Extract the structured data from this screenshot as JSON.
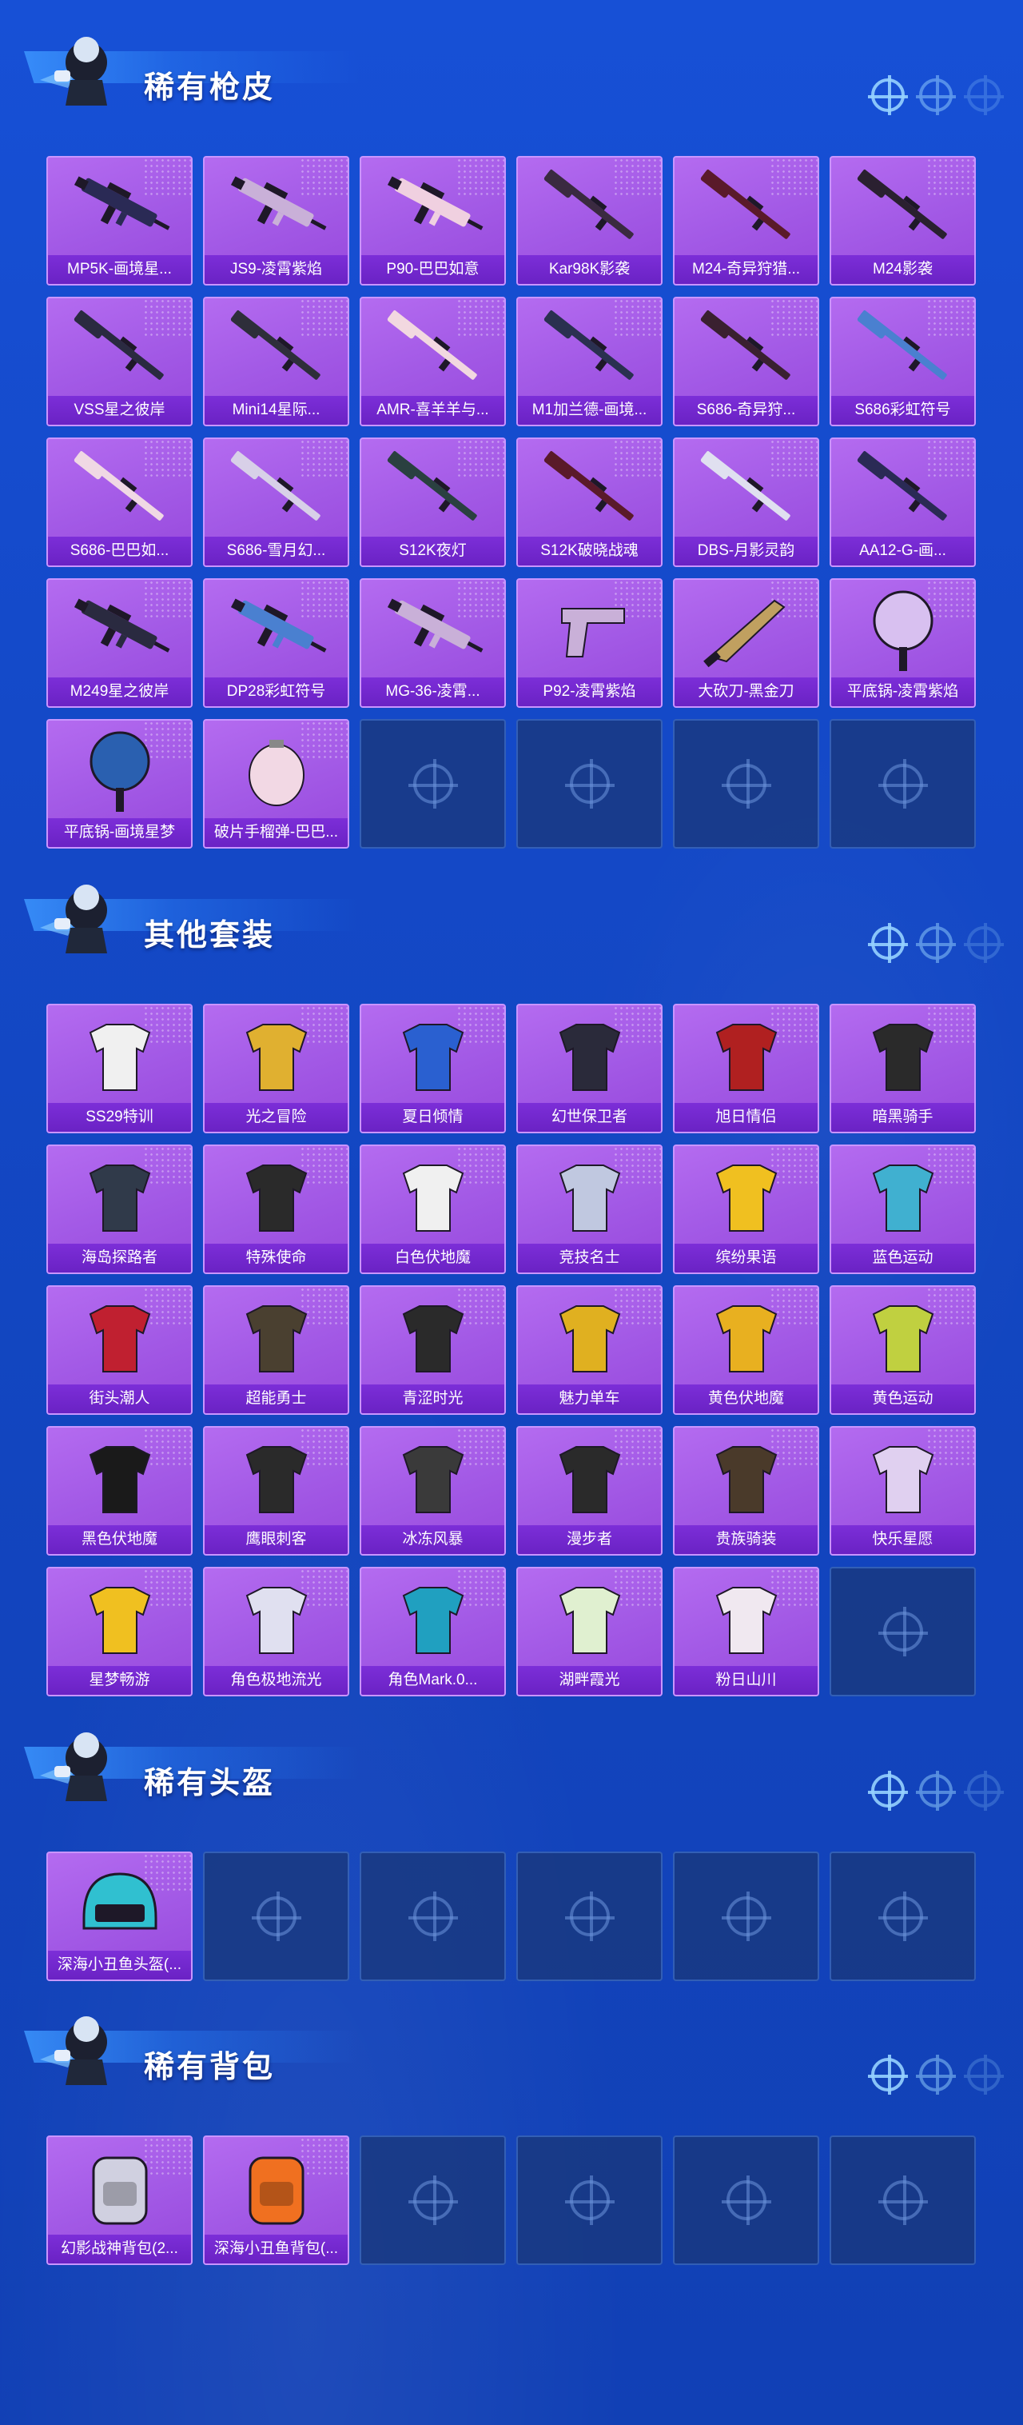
{
  "sections": [
    {
      "title": "稀有枪皮",
      "rows": 5,
      "items": [
        {
          "label": "MP5K-画境星...",
          "icon": "smg-icon",
          "color": "#2a2a55"
        },
        {
          "label": "JS9-凌霄紫焰",
          "icon": "smg-icon",
          "color": "#c9b0d8"
        },
        {
          "label": "P90-巴巴如意",
          "icon": "smg-icon",
          "color": "#f0d0e0"
        },
        {
          "label": "Kar98K影袭",
          "icon": "rifle-icon",
          "color": "#3a2a40"
        },
        {
          "label": "M24-奇异狩猎...",
          "icon": "rifle-icon",
          "color": "#5a1a2a"
        },
        {
          "label": "M24影袭",
          "icon": "rifle-icon",
          "color": "#2a2030"
        },
        {
          "label": "VSS星之彼岸",
          "icon": "rifle-icon",
          "color": "#2a2a40"
        },
        {
          "label": "Mini14星际...",
          "icon": "rifle-icon",
          "color": "#2e2e3a"
        },
        {
          "label": "AMR-喜羊羊与...",
          "icon": "rifle-icon",
          "color": "#f2d8e0"
        },
        {
          "label": "M1加兰德-画境...",
          "icon": "rifle-icon",
          "color": "#2a3050"
        },
        {
          "label": "S686-奇异狩...",
          "icon": "shotgun-icon",
          "color": "#3a2030"
        },
        {
          "label": "S686彩虹符号",
          "icon": "shotgun-icon",
          "color": "#4a80d0"
        },
        {
          "label": "S686-巴巴如...",
          "icon": "shotgun-icon",
          "color": "#f0d8e4"
        },
        {
          "label": "S686-雪月幻...",
          "icon": "shotgun-icon",
          "color": "#d8d0e8"
        },
        {
          "label": "S12K夜灯",
          "icon": "shotgun-icon",
          "color": "#2a4040"
        },
        {
          "label": "S12K破晓战魂",
          "icon": "shotgun-icon",
          "color": "#5a1a2a"
        },
        {
          "label": "DBS-月影灵韵",
          "icon": "shotgun-icon",
          "color": "#e0e0f0"
        },
        {
          "label": "AA12-G-画...",
          "icon": "shotgun-icon",
          "color": "#2a2a55"
        },
        {
          "label": "M249星之彼岸",
          "icon": "lmg-icon",
          "color": "#2a2a40"
        },
        {
          "label": "DP28彩虹符号",
          "icon": "lmg-icon",
          "color": "#4a80d0"
        },
        {
          "label": "MG-36-凌霄...",
          "icon": "lmg-icon",
          "color": "#c9b0d8"
        },
        {
          "label": "P92-凌霄紫焰",
          "icon": "pistol-icon",
          "color": "#c9b0d8"
        },
        {
          "label": "大砍刀-黑金刀",
          "icon": "machete-icon",
          "color": "#2a2a2a"
        },
        {
          "label": "平底锅-凌霄紫焰",
          "icon": "pan-icon",
          "color": "#d8c0f0"
        },
        {
          "label": "平底锅-画境星梦",
          "icon": "pan-icon",
          "color": "#2a60b0"
        },
        {
          "label": "破片手榴弹-巴巴...",
          "icon": "grenade-icon",
          "color": "#f2d8e4"
        }
      ]
    },
    {
      "title": "其他套装",
      "rows": 5,
      "items": [
        {
          "label": "SS29特训",
          "icon": "outfit-icon",
          "color": "#f0f0f0"
        },
        {
          "label": "光之冒险",
          "icon": "outfit-icon",
          "color": "#e0b030"
        },
        {
          "label": "夏日倾情",
          "icon": "outfit-icon",
          "color": "#2a60d0"
        },
        {
          "label": "幻世保卫者",
          "icon": "outfit-icon",
          "color": "#2a2a3a"
        },
        {
          "label": "旭日情侣",
          "icon": "outfit-icon",
          "color": "#b02020"
        },
        {
          "label": "暗黑骑手",
          "icon": "outfit-icon",
          "color": "#2a2a2a"
        },
        {
          "label": "海岛探路者",
          "icon": "outfit-icon",
          "color": "#303a4a"
        },
        {
          "label": "特殊使命",
          "icon": "outfit-icon",
          "color": "#2a2a2a"
        },
        {
          "label": "白色伏地魔",
          "icon": "outfit-icon",
          "color": "#f0f0f0"
        },
        {
          "label": "竞技名士",
          "icon": "outfit-icon",
          "color": "#c0c8e0"
        },
        {
          "label": "缤纷果语",
          "icon": "outfit-icon",
          "color": "#f0c020"
        },
        {
          "label": "蓝色运动",
          "icon": "outfit-icon",
          "color": "#40b0d0"
        },
        {
          "label": "街头潮人",
          "icon": "outfit-icon",
          "color": "#c02030"
        },
        {
          "label": "超能勇士",
          "icon": "outfit-icon",
          "color": "#4a4030"
        },
        {
          "label": "青涩时光",
          "icon": "outfit-icon",
          "color": "#2a2a2a"
        },
        {
          "label": "魅力单车",
          "icon": "outfit-icon",
          "color": "#e0b020"
        },
        {
          "label": "黄色伏地魔",
          "icon": "outfit-icon",
          "color": "#e8b020"
        },
        {
          "label": "黄色运动",
          "icon": "outfit-icon",
          "color": "#c0d040"
        },
        {
          "label": "黑色伏地魔",
          "icon": "outfit-icon",
          "color": "#1a1a1a"
        },
        {
          "label": "鹰眼刺客",
          "icon": "outfit-icon",
          "color": "#2a2a2a"
        },
        {
          "label": "冰冻风暴",
          "icon": "outfit-icon",
          "color": "#3a3a3a"
        },
        {
          "label": "漫步者",
          "icon": "outfit-icon",
          "color": "#2a2a2a"
        },
        {
          "label": "贵族骑装",
          "icon": "outfit-icon",
          "color": "#4a3a2a"
        },
        {
          "label": "快乐星愿",
          "icon": "outfit-icon",
          "color": "#e0d0f0"
        },
        {
          "label": "星梦畅游",
          "icon": "outfit-icon",
          "color": "#f0c020"
        },
        {
          "label": "角色极地流光",
          "icon": "outfit-icon",
          "color": "#e0e0f0"
        },
        {
          "label": "角色Mark.0...",
          "icon": "outfit-icon",
          "color": "#20a0c0"
        },
        {
          "label": "湖畔霞光",
          "icon": "outfit-icon",
          "color": "#e0f0d0"
        },
        {
          "label": "粉日山川",
          "icon": "outfit-icon",
          "color": "#f0e8f0"
        }
      ]
    },
    {
      "title": "稀有头盔",
      "rows": 1,
      "items": [
        {
          "label": "深海小丑鱼头盔(...",
          "icon": "helmet-icon",
          "color": "#30c0d0"
        }
      ]
    },
    {
      "title": "稀有背包",
      "rows": 1,
      "items": [
        {
          "label": "幻影战神背包(2...",
          "icon": "backpack-icon",
          "color": "#d0d0e0"
        },
        {
          "label": "深海小丑鱼背包(...",
          "icon": "backpack-icon",
          "color": "#f07020"
        }
      ]
    }
  ]
}
